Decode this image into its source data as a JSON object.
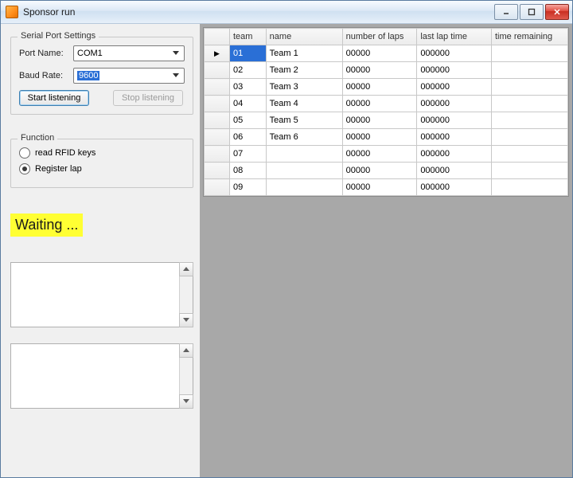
{
  "window": {
    "title": "Sponsor run"
  },
  "serial": {
    "legend": "Serial Port Settings",
    "port_label": "Port Name:",
    "port_value": "COM1",
    "baud_label": "Baud Rate:",
    "baud_value": "9600"
  },
  "buttons": {
    "start": "Start listening",
    "stop": "Stop listening"
  },
  "function": {
    "legend": "Function",
    "read": "read RFID keys",
    "register": "Register lap",
    "selected": "register"
  },
  "status": "Waiting ...",
  "grid": {
    "headers": {
      "team": "team",
      "name": "name",
      "laps": "number of laps",
      "last": "last lap time",
      "remaining": "time remaining"
    },
    "rows": [
      {
        "team": "01",
        "name": "Team 1",
        "laps": "00000",
        "last": "000000",
        "remaining": ""
      },
      {
        "team": "02",
        "name": "Team 2",
        "laps": "00000",
        "last": "000000",
        "remaining": ""
      },
      {
        "team": "03",
        "name": "Team 3",
        "laps": "00000",
        "last": "000000",
        "remaining": ""
      },
      {
        "team": "04",
        "name": "Team 4",
        "laps": "00000",
        "last": "000000",
        "remaining": ""
      },
      {
        "team": "05",
        "name": "Team 5",
        "laps": "00000",
        "last": "000000",
        "remaining": ""
      },
      {
        "team": "06",
        "name": "Team 6",
        "laps": "00000",
        "last": "000000",
        "remaining": ""
      },
      {
        "team": "07",
        "name": "",
        "laps": "00000",
        "last": "000000",
        "remaining": ""
      },
      {
        "team": "08",
        "name": "",
        "laps": "00000",
        "last": "000000",
        "remaining": ""
      },
      {
        "team": "09",
        "name": "",
        "laps": "00000",
        "last": "000000",
        "remaining": ""
      }
    ],
    "selected_row": 0,
    "selected_col": "team"
  }
}
